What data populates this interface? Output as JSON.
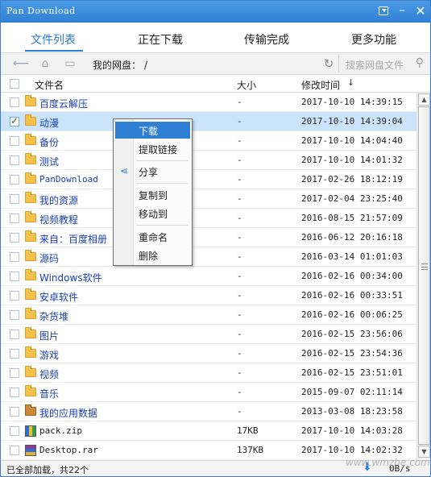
{
  "window": {
    "title": "Pan Download",
    "buttons": {
      "download_mgr": "download-box-icon",
      "minimize": "–",
      "close": "✕"
    }
  },
  "tabs": [
    {
      "label": "文件列表",
      "active": true
    },
    {
      "label": "正在下载",
      "active": false
    },
    {
      "label": "传输完成",
      "active": false
    },
    {
      "label": "更多功能",
      "active": false
    }
  ],
  "toolbar": {
    "path": "我的网盘： /",
    "search_placeholder": "搜索网盘文件",
    "icons": [
      "back-arrow-icon",
      "home-icon",
      "folder-icon",
      "refresh-icon",
      "search-icon"
    ]
  },
  "columns": {
    "name": "文件名",
    "size": "大小",
    "modified": "修改时间",
    "sort_indicator": "↓"
  },
  "files": [
    {
      "name": "百度云解压",
      "size": "-",
      "date": "2017-10-10 14:39:15",
      "type": "folder",
      "checked": false,
      "selected": false
    },
    {
      "name": "动漫",
      "size": "-",
      "date": "2017-10-10 14:39:04",
      "type": "folder",
      "checked": true,
      "selected": true
    },
    {
      "name": "备份",
      "size": "-",
      "date": "2017-10-10 14:04:40",
      "type": "folder",
      "checked": false,
      "selected": false
    },
    {
      "name": "测试",
      "size": "-",
      "date": "2017-10-10 14:01:32",
      "type": "folder",
      "checked": false,
      "selected": false
    },
    {
      "name": "PanDownload",
      "size": "-",
      "date": "2017-02-26 18:12:19",
      "type": "folder",
      "checked": false,
      "selected": false,
      "mono": true
    },
    {
      "name": "我的资源",
      "size": "-",
      "date": "2017-02-04 23:25:40",
      "type": "folder",
      "checked": false,
      "selected": false
    },
    {
      "name": "视频教程",
      "size": "-",
      "date": "2016-08-15 21:57:09",
      "type": "folder",
      "checked": false,
      "selected": false
    },
    {
      "name": "来自：百度相册",
      "size": "-",
      "date": "2016-06-12 20:16:18",
      "type": "folder",
      "checked": false,
      "selected": false
    },
    {
      "name": "源码",
      "size": "-",
      "date": "2016-03-14 01:01:03",
      "type": "folder",
      "checked": false,
      "selected": false
    },
    {
      "name": "Windows软件",
      "size": "-",
      "date": "2016-02-16 00:34:00",
      "type": "folder",
      "checked": false,
      "selected": false
    },
    {
      "name": "安卓软件",
      "size": "-",
      "date": "2016-02-16 00:33:51",
      "type": "folder",
      "checked": false,
      "selected": false
    },
    {
      "name": "杂货堆",
      "size": "-",
      "date": "2016-02-16 00:06:25",
      "type": "folder",
      "checked": false,
      "selected": false
    },
    {
      "name": "图片",
      "size": "-",
      "date": "2016-02-15 23:56:06",
      "type": "folder",
      "checked": false,
      "selected": false
    },
    {
      "name": "游戏",
      "size": "-",
      "date": "2016-02-15 23:54:36",
      "type": "folder",
      "checked": false,
      "selected": false
    },
    {
      "name": "视频",
      "size": "-",
      "date": "2016-02-15 23:51:01",
      "type": "folder",
      "checked": false,
      "selected": false
    },
    {
      "name": "音乐",
      "size": "-",
      "date": "2015-09-07 02:11:14",
      "type": "folder",
      "checked": false,
      "selected": false
    },
    {
      "name": "我的应用数据",
      "size": "-",
      "date": "2013-03-08 18:23:58",
      "type": "app-folder",
      "checked": false,
      "selected": false
    },
    {
      "name": "pack.zip",
      "size": "17KB",
      "date": "2017-10-10 14:03:28",
      "type": "zip",
      "checked": false,
      "selected": false,
      "mono": true
    },
    {
      "name": "Desktop.rar",
      "size": "137KB",
      "date": "2017-10-10 14:02:32",
      "type": "rar",
      "checked": false,
      "selected": false,
      "mono": true
    }
  ],
  "context_menu": {
    "items": [
      {
        "label": "下载",
        "hover": true
      },
      {
        "label": "提取链接"
      },
      {
        "label": "分享",
        "icon": "share-icon"
      },
      {
        "label": "复制到"
      },
      {
        "label": "移动到"
      },
      {
        "label": "重命名"
      },
      {
        "label": "删除"
      }
    ]
  },
  "status": {
    "text": "已全部加载，共22个",
    "speed": "0B/s",
    "watermark": "www.wmzhe.com"
  }
}
